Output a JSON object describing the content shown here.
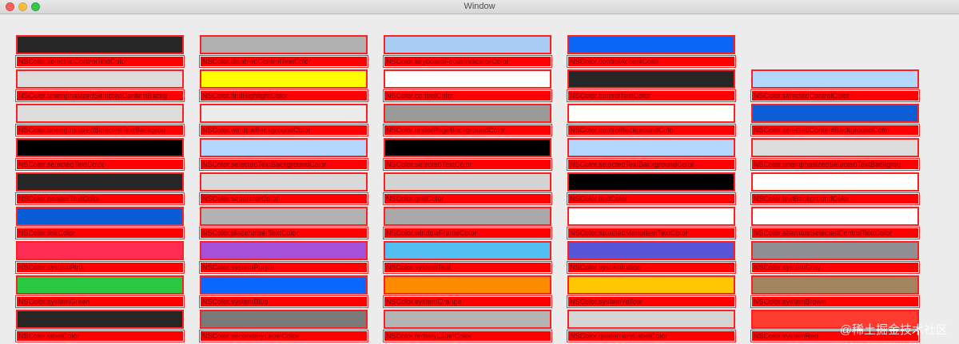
{
  "window": {
    "title": "Window"
  },
  "watermark": "@稀土掘金技术社区",
  "columns": [
    [
      {
        "label": "NSColor.selectedControlTextColor",
        "color": "#262626"
      },
      {
        "label": "NSColor.unemphasizedSelectedContentBackg",
        "color": "#dcdcdc"
      },
      {
        "label": "NSColor.unemphasizedSelectedTextBackgrou",
        "color": "#dcdcdc"
      },
      {
        "label": "NSColor.selectedTextColor",
        "color": "#000000"
      },
      {
        "label": "NSColor.headerTextColor",
        "color": "#262626"
      },
      {
        "label": "NSColor.linkColor",
        "color": "#0a5bd6"
      },
      {
        "label": "NSColor.systemPink",
        "color": "#ff2d55"
      },
      {
        "label": "NSColor.systemGreen",
        "color": "#28c940"
      },
      {
        "label": "NSColor.labelColor",
        "color": "#262626"
      }
    ],
    [
      {
        "label": "NSColor.disabledControlTextColor",
        "color": "#b0b0b0"
      },
      {
        "label": "NSColor.findHighlightColor",
        "color": "#ffff00"
      },
      {
        "label": "NSColor.windowBackgroundColor",
        "color": "#ececec"
      },
      {
        "label": "NSColor.selectedTextBackgroundColor",
        "color": "#b3d7ff"
      },
      {
        "label": "NSColor.separatorColor",
        "color": "#d9d9d9"
      },
      {
        "label": "NSColor.placeholderTextColor",
        "color": "#b3b3b3"
      },
      {
        "label": "NSColor.systemPurple",
        "color": "#a550d9"
      },
      {
        "label": "NSColor.systemBlue",
        "color": "#0b68ff"
      },
      {
        "label": "NSColor.secondaryLabelColor",
        "color": "#7a7a7a"
      }
    ],
    [
      {
        "label": "NSColor.keyboardFocusIndicatorColor",
        "color": "#a9ccf5"
      },
      {
        "label": "NSColor.controlColor",
        "color": "#ffffff"
      },
      {
        "label": "NSColor.underPageBackgroundColor",
        "color": "#9a9a9a"
      },
      {
        "label": "NSColor.selectedTextColor",
        "color": "#000000"
      },
      {
        "label": "NSColor.gridColor",
        "color": "#d3d3d3"
      },
      {
        "label": "NSColor.windowFrameColor",
        "color": "#a9a9a9"
      },
      {
        "label": "NSColor.systemTeal",
        "color": "#55bef0"
      },
      {
        "label": "NSColor.systemOrange",
        "color": "#ff8c00"
      },
      {
        "label": "NSColor.tertiaryLabelColor",
        "color": "#b4b4b4"
      }
    ],
    [
      {
        "label": "NSColor.controlAccentColor",
        "color": "#0b65f5"
      },
      {
        "label": "NSColor.controlTextColor",
        "color": "#262626"
      },
      {
        "label": "NSColor.controlBackgroundColor",
        "color": "#ffffff"
      },
      {
        "label": "NSColor.selectedTextBackgroundColor",
        "color": "#b3d7ff"
      },
      {
        "label": "NSColor.textColor",
        "color": "#000000"
      },
      {
        "label": "NSColor.selectedMenuItemTextColor",
        "color": "#ffffff"
      },
      {
        "label": "NSColor.systemIndigo",
        "color": "#5856d6"
      },
      {
        "label": "NSColor.systemYellow",
        "color": "#ffc700"
      },
      {
        "label": "NSColor.quaternaryLabelColor",
        "color": "#d4d4d4"
      }
    ],
    [
      null,
      {
        "label": "NSColor.selectedControlColor",
        "color": "#b3d7ff"
      },
      {
        "label": "NSColor.selectedContentBackgroundColor",
        "color": "#0b5cd5"
      },
      {
        "label": "NSColor.unemphasizedSelectedTextBackgrou",
        "color": "#dcdcdc"
      },
      {
        "label": "NSColor.textBackgroundColor",
        "color": "#ffffff"
      },
      {
        "label": "NSColor.alternateSelectedControlTextColor",
        "color": "#ffffff"
      },
      {
        "label": "NSColor.systemGray",
        "color": "#8e8e93"
      },
      {
        "label": "NSColor.systemBrown",
        "color": "#a2845e"
      },
      {
        "label": "NSColor.systemRed",
        "color": "#ff3b30"
      }
    ]
  ]
}
